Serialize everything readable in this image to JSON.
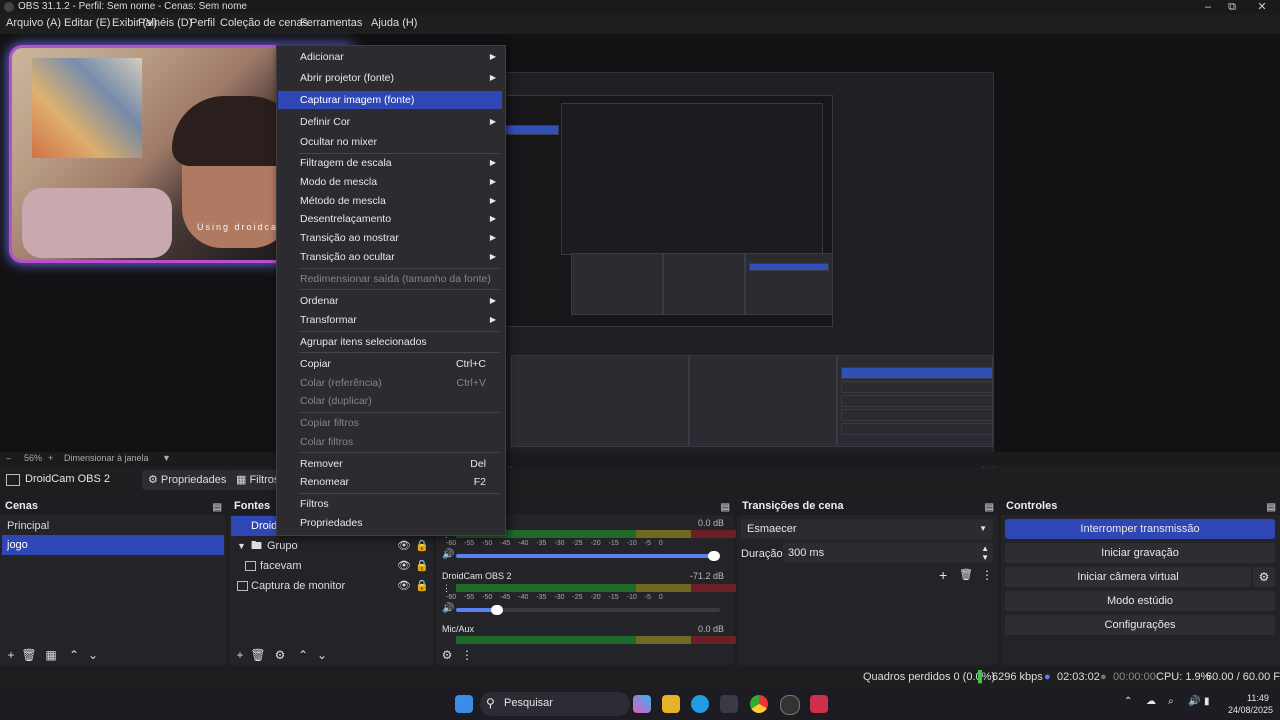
{
  "window": {
    "title": "OBS 31.1.2 - Perfil: Sem nome - Cenas: Sem nome"
  },
  "menubar": [
    "Arquivo (A)",
    "Editar (E)",
    "Exibir (V)",
    "Painéis (D)",
    "Perfil",
    "Coleção de cenas",
    "Ferramentas",
    "Ajuda (H)"
  ],
  "webcam": {
    "watermark": "Using droidcam.app"
  },
  "zoombar": {
    "zoom": "56%",
    "resize_label": "Dimensionar à janela"
  },
  "source_toolbar": {
    "selected_source": "DroidCam OBS 2",
    "properties_label": "Propriedades",
    "filters_label": "Filtros"
  },
  "scenes": {
    "title": "Cenas",
    "items": [
      {
        "label": "Principal",
        "selected": false
      },
      {
        "label": "jogo",
        "selected": true
      }
    ]
  },
  "sources": {
    "title": "Fontes",
    "items": [
      {
        "label": "DroidCam OBS 2",
        "selected": true,
        "indent": 0
      },
      {
        "label": "Grupo",
        "selected": false,
        "indent": 0
      },
      {
        "label": "facevam",
        "selected": false,
        "indent": 1
      },
      {
        "label": "Captura de monitor",
        "selected": false,
        "indent": 0
      }
    ]
  },
  "mixer": {
    "ticks": "-60 -55 -50 -45 -40 -35 -30 -25 -20 -15 -10 -5 0",
    "channels": [
      {
        "name": "",
        "db": "0.0 dB",
        "volume": 1.0
      },
      {
        "name": "DroidCam OBS 2",
        "db": "-71.2 dB",
        "volume": 0.14
      },
      {
        "name": "Mic/Aux",
        "db": "0.0 dB",
        "volume": 1.0
      }
    ]
  },
  "transitions": {
    "title": "Transições de cena",
    "selected": "Esmaecer",
    "duration_label": "Duração",
    "duration_value": "300 ms"
  },
  "controls": {
    "title": "Controles",
    "buttons": [
      {
        "label": "Interromper transmissão",
        "active": true
      },
      {
        "label": "Iniciar gravação",
        "active": false
      },
      {
        "label": "Iniciar câmera virtual",
        "active": false
      },
      {
        "label": "Modo estúdio",
        "active": false
      },
      {
        "label": "Configurações",
        "active": false
      }
    ]
  },
  "status": {
    "dropped": "Quadros perdidos 0 (0.0%)",
    "bitrate": "6296 kbps",
    "stream_time": "02:03:02",
    "rec_time": "00:00:00",
    "cpu": "CPU: 1.9%",
    "fps": "60.00 / 60.00 FPS"
  },
  "taskbar": {
    "search_label": "Pesquisar",
    "time": "11:49",
    "date": "24/08/2025"
  },
  "context_menu": {
    "items": [
      {
        "label": "Adicionar",
        "shortcut": "",
        "submenu": true,
        "disabled": false,
        "highlight": false
      },
      {
        "label": "Abrir projetor (fonte)",
        "shortcut": "",
        "submenu": true,
        "disabled": false,
        "highlight": false
      },
      {
        "label": "Capturar imagem (fonte)",
        "shortcut": "",
        "submenu": false,
        "disabled": false,
        "highlight": true
      },
      {
        "label": "Definir Cor",
        "shortcut": "",
        "submenu": true,
        "disabled": false,
        "highlight": false
      },
      {
        "label": "Ocultar no mixer",
        "shortcut": "",
        "submenu": false,
        "disabled": false,
        "highlight": false
      },
      {
        "label": "Filtragem de escala",
        "shortcut": "",
        "submenu": true,
        "disabled": false,
        "highlight": false
      },
      {
        "label": "Modo de mescla",
        "shortcut": "",
        "submenu": true,
        "disabled": false,
        "highlight": false
      },
      {
        "label": "Método de mescla",
        "shortcut": "",
        "submenu": true,
        "disabled": false,
        "highlight": false
      },
      {
        "label": "Desentrelaçamento",
        "shortcut": "",
        "submenu": true,
        "disabled": false,
        "highlight": false
      },
      {
        "label": "Transição ao mostrar",
        "shortcut": "",
        "submenu": true,
        "disabled": false,
        "highlight": false
      },
      {
        "label": "Transição ao ocultar",
        "shortcut": "",
        "submenu": true,
        "disabled": false,
        "highlight": false
      },
      {
        "label": "Redimensionar saída (tamanho da fonte)",
        "shortcut": "",
        "submenu": false,
        "disabled": true,
        "highlight": false
      },
      {
        "label": "Ordenar",
        "shortcut": "",
        "submenu": true,
        "disabled": false,
        "highlight": false
      },
      {
        "label": "Transformar",
        "shortcut": "",
        "submenu": true,
        "disabled": false,
        "highlight": false
      },
      {
        "label": "Agrupar itens selecionados",
        "shortcut": "",
        "submenu": false,
        "disabled": false,
        "highlight": false
      },
      {
        "label": "Copiar",
        "shortcut": "Ctrl+C",
        "submenu": false,
        "disabled": false,
        "highlight": false
      },
      {
        "label": "Colar (referência)",
        "shortcut": "Ctrl+V",
        "submenu": false,
        "disabled": true,
        "highlight": false
      },
      {
        "label": "Colar (duplicar)",
        "shortcut": "",
        "submenu": false,
        "disabled": true,
        "highlight": false
      },
      {
        "label": "Copiar filtros",
        "shortcut": "",
        "submenu": false,
        "disabled": true,
        "highlight": false
      },
      {
        "label": "Colar filtros",
        "shortcut": "",
        "submenu": false,
        "disabled": true,
        "highlight": false
      },
      {
        "label": "Remover",
        "shortcut": "Del",
        "submenu": false,
        "disabled": false,
        "highlight": false
      },
      {
        "label": "Renomear",
        "shortcut": "F2",
        "submenu": false,
        "disabled": false,
        "highlight": false
      },
      {
        "label": "Filtros",
        "shortcut": "",
        "submenu": false,
        "disabled": false,
        "highlight": false
      },
      {
        "label": "Propriedades",
        "shortcut": "",
        "submenu": false,
        "disabled": false,
        "highlight": false
      }
    ]
  }
}
